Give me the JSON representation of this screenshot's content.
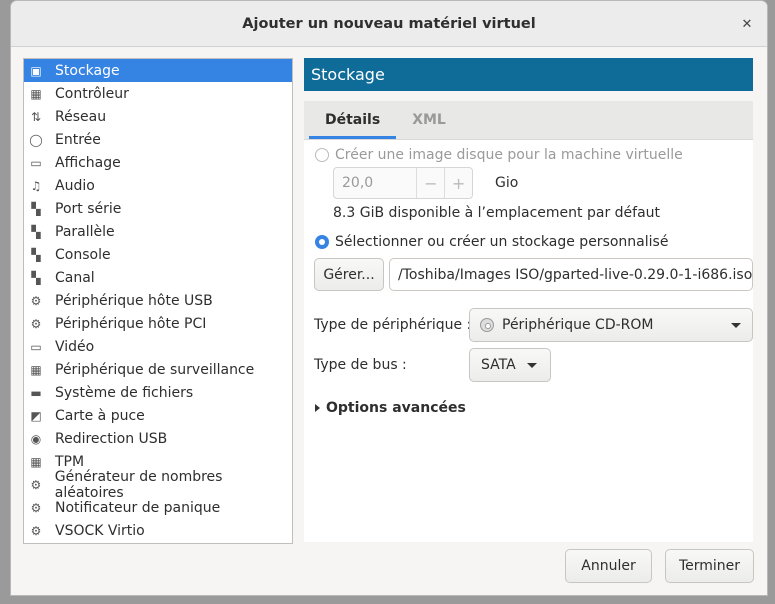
{
  "window": {
    "title": "Ajouter un nouveau matériel virtuel",
    "close_glyph": "✕"
  },
  "sidebar": {
    "items": [
      {
        "label": "Stockage",
        "icon": "disk-icon",
        "glyph": "▣"
      },
      {
        "label": "Contrôleur",
        "icon": "controller-icon",
        "glyph": "▦"
      },
      {
        "label": "Réseau",
        "icon": "network-icon",
        "glyph": "⇅"
      },
      {
        "label": "Entrée",
        "icon": "mouse-icon",
        "glyph": "◯"
      },
      {
        "label": "Affichage",
        "icon": "monitor-icon",
        "glyph": "▭"
      },
      {
        "label": "Audio",
        "icon": "audio-icon",
        "glyph": "♫"
      },
      {
        "label": "Port série",
        "icon": "serial-port-icon",
        "glyph": "▚"
      },
      {
        "label": "Parallèle",
        "icon": "parallel-port-icon",
        "glyph": "▚"
      },
      {
        "label": "Console",
        "icon": "console-icon",
        "glyph": "▚"
      },
      {
        "label": "Canal",
        "icon": "channel-icon",
        "glyph": "▚"
      },
      {
        "label": "Périphérique hôte USB",
        "icon": "usb-host-icon",
        "glyph": "⚙"
      },
      {
        "label": "Périphérique hôte PCI",
        "icon": "pci-host-icon",
        "glyph": "⚙"
      },
      {
        "label": "Vidéo",
        "icon": "video-icon",
        "glyph": "▭"
      },
      {
        "label": "Périphérique de surveillance",
        "icon": "watchdog-icon",
        "glyph": "▦"
      },
      {
        "label": "Système de fichiers",
        "icon": "filesystem-icon",
        "glyph": "▬"
      },
      {
        "label": "Carte à puce",
        "icon": "smartcard-icon",
        "glyph": "◩"
      },
      {
        "label": "Redirection USB",
        "icon": "usb-redirect-icon",
        "glyph": "◉"
      },
      {
        "label": "TPM",
        "icon": "tpm-icon",
        "glyph": "▦"
      },
      {
        "label": "Générateur de nombres aléatoires",
        "icon": "rng-icon",
        "glyph": "⚙"
      },
      {
        "label": "Notificateur de panique",
        "icon": "panic-icon",
        "glyph": "⚙"
      },
      {
        "label": "VSOCK Virtio",
        "icon": "vsock-icon",
        "glyph": "⚙"
      }
    ],
    "selected_index": 0
  },
  "panel": {
    "title": "Stockage",
    "tabs": [
      {
        "label": "Détails",
        "active": true
      },
      {
        "label": "XML",
        "active": false
      }
    ],
    "create_image_label": "Créer une image disque pour la machine virtuelle",
    "size_value": "20,0",
    "minus": "−",
    "plus": "+",
    "size_unit": "Gio",
    "available_text": "8.3 GiB disponible à l’emplacement par défaut",
    "custom_storage_label": "Sélectionner ou créer un stockage personnalisé",
    "manage_button": "Gérer...",
    "path_value": "/Toshiba/Images ISO/gparted-live-0.29.0-1-i686.iso",
    "device_type_label": "Type de périphérique :",
    "device_type_value": "Périphérique CD-ROM",
    "bus_type_label": "Type de bus :",
    "bus_type_value": "SATA",
    "advanced_options": "Options avancées"
  },
  "footer": {
    "cancel": "Annuler",
    "finish": "Terminer"
  },
  "colors": {
    "accent": "#3584e4",
    "header": "#0f6c99"
  }
}
